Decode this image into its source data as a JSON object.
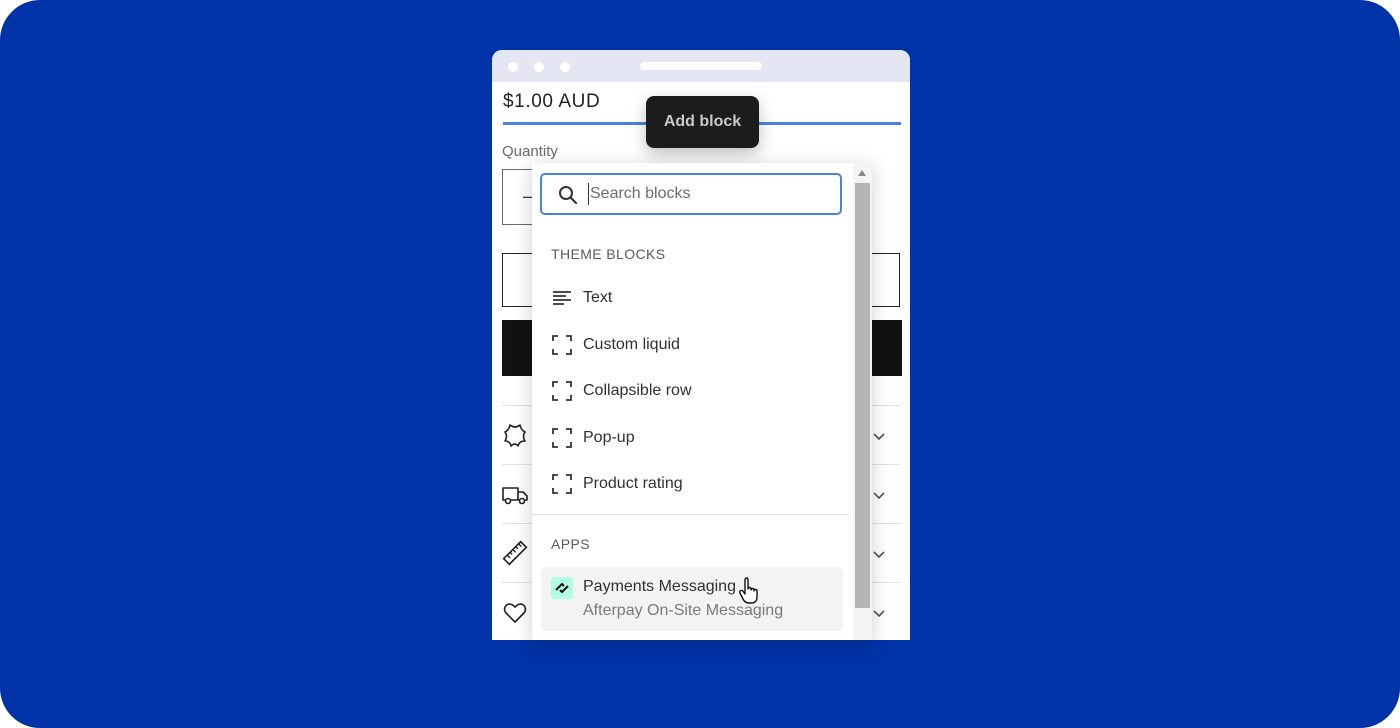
{
  "product": {
    "price": "$1.00 AUD",
    "quantity_label": "Quantity",
    "quantity_minus": "–"
  },
  "tooltip": {
    "label": "Add block"
  },
  "search": {
    "placeholder": "Search blocks"
  },
  "theme_blocks": {
    "heading": "THEME BLOCKS",
    "items": [
      {
        "label": "Text",
        "icon": "text-align-icon"
      },
      {
        "label": "Custom liquid",
        "icon": "block-frame-icon"
      },
      {
        "label": "Collapsible row",
        "icon": "block-frame-icon"
      },
      {
        "label": "Pop-up",
        "icon": "block-frame-icon"
      },
      {
        "label": "Product rating",
        "icon": "block-frame-icon"
      }
    ]
  },
  "apps": {
    "heading": "APPS",
    "items": [
      {
        "title": "Payments Messaging",
        "subtitle": "Afterpay On-Site Messaging",
        "icon": "afterpay-icon",
        "icon_bg": "#b2fce4"
      }
    ]
  },
  "background_rows": [
    {
      "icon": "leather-icon"
    },
    {
      "icon": "truck-icon"
    },
    {
      "icon": "ruler-icon"
    },
    {
      "icon": "heart-icon"
    }
  ],
  "colors": {
    "stage": "#0033a8",
    "accent": "#4a82e0",
    "tooltip": "#1c1c1c",
    "dark_button": "#121212"
  }
}
